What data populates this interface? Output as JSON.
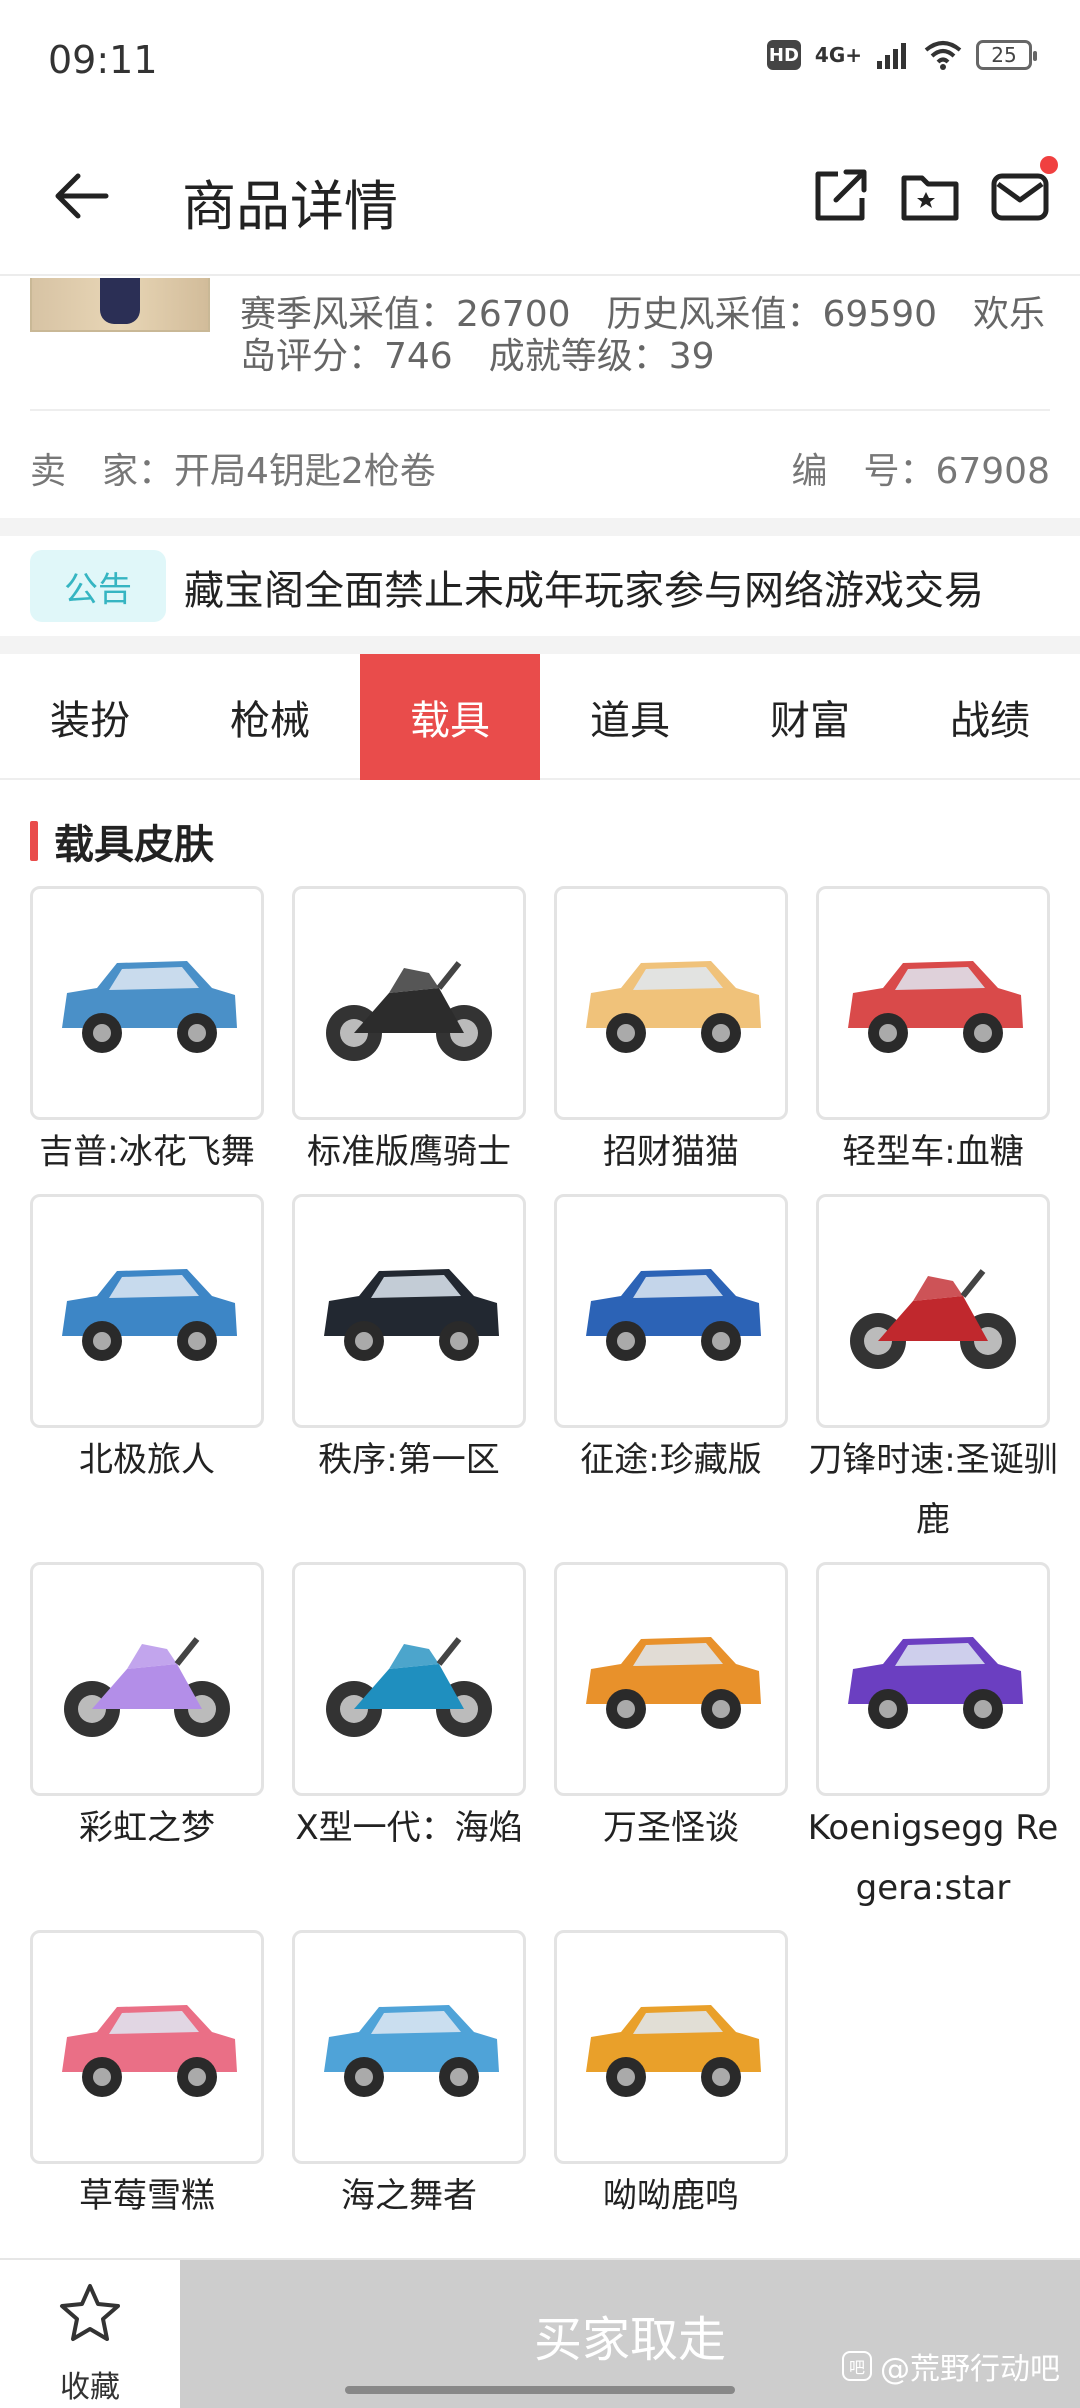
{
  "status_bar": {
    "time": "09:11",
    "hd": "HD",
    "network": "4G+",
    "battery": "25"
  },
  "nav": {
    "title": "商品详情"
  },
  "info": {
    "stats_line1": "赛季风采值：26700　历史风采值：69590　欢乐",
    "stats_line2": "岛评分：746　成就等级：39",
    "seller_label": "卖　家：开局4钥匙2枪卷",
    "serial_label": "编　号：67908"
  },
  "notice": {
    "badge": "公告",
    "text": "藏宝阁全面禁止未成年玩家参与网络游戏交易"
  },
  "tabs": [
    {
      "label": "装扮"
    },
    {
      "label": "枪械"
    },
    {
      "label": "载具"
    },
    {
      "label": "道具"
    },
    {
      "label": "财富"
    },
    {
      "label": "战绩"
    }
  ],
  "section": {
    "title": "载具皮肤"
  },
  "vehicles": [
    {
      "name": "吉普:冰花飞舞",
      "icon": "jeep-icon",
      "color": "#4a90c8"
    },
    {
      "name": "标准版鹰骑士",
      "icon": "motorcycle-icon",
      "color": "#2c2c2c"
    },
    {
      "name": "招财猫猫",
      "icon": "van-icon",
      "color": "#f0c27a"
    },
    {
      "name": "轻型车:血糖",
      "icon": "food-truck-icon",
      "color": "#d94a4a"
    },
    {
      "name": "北极旅人",
      "icon": "mini-car-icon",
      "color": "#3d86c6"
    },
    {
      "name": "秩序:第一区",
      "icon": "sports-car-icon",
      "color": "#222831"
    },
    {
      "name": "征途:珍藏版",
      "icon": "suv-icon",
      "color": "#2c63b6"
    },
    {
      "name": "刀锋时速:圣诞驯鹿",
      "icon": "reindeer-motorcycle-icon",
      "color": "#c0282d"
    },
    {
      "name": "彩虹之梦",
      "icon": "rainbow-motorcycle-icon",
      "color": "#b38ee8"
    },
    {
      "name": "X型一代：海焰",
      "icon": "sea-motorcycle-icon",
      "color": "#1f8fbf"
    },
    {
      "name": "万圣怪谈",
      "icon": "pickup-truck-icon",
      "color": "#e8912b"
    },
    {
      "name": "Koenigsegg Regera:star",
      "icon": "supercar-icon",
      "color": "#6b3fc1"
    },
    {
      "name": "草莓雪糕",
      "icon": "ice-cream-truck-icon",
      "color": "#ea6f86"
    },
    {
      "name": "海之舞者",
      "icon": "whale-van-icon",
      "color": "#4fa3d8"
    },
    {
      "name": "呦呦鹿鸣",
      "icon": "deer-van-icon",
      "color": "#e9a02a"
    }
  ],
  "bottom": {
    "fav_label": "收藏",
    "buy_label": "买家取走",
    "watermark": "@荒野行动吧"
  }
}
